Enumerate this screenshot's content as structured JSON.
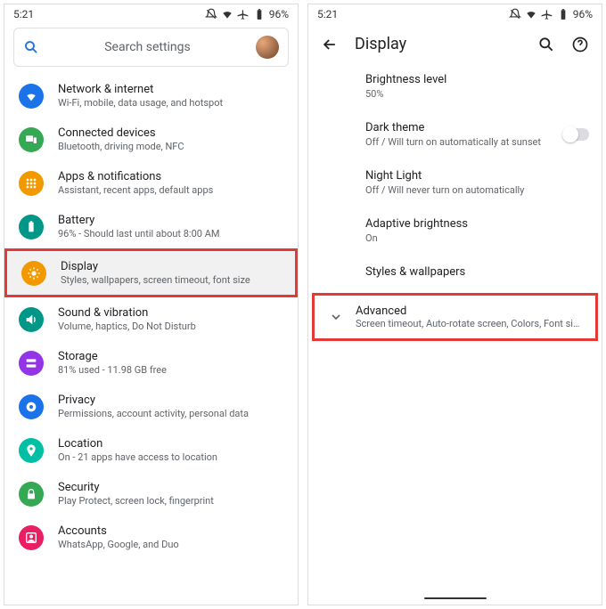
{
  "status": {
    "time": "5:21",
    "battery": "96%"
  },
  "search": {
    "placeholder": "Search settings"
  },
  "settings": [
    {
      "icon": "wifi",
      "color": "#1a73e8",
      "title": "Network & internet",
      "sub": "Wi-Fi, mobile, data usage, and hotspot"
    },
    {
      "icon": "devices",
      "color": "#34a853",
      "title": "Connected devices",
      "sub": "Bluetooth, driving mode, NFC"
    },
    {
      "icon": "apps",
      "color": "#f29900",
      "title": "Apps & notifications",
      "sub": "Assistant, recent apps, default apps"
    },
    {
      "icon": "battery",
      "color": "#009688",
      "title": "Battery",
      "sub": "96% - Should last until about 8:00 AM"
    },
    {
      "icon": "display",
      "color": "#f29900",
      "title": "Display",
      "sub": "Styles, wallpapers, screen timeout, font size",
      "highlight": true
    },
    {
      "icon": "sound",
      "color": "#009688",
      "title": "Sound & vibration",
      "sub": "Volume, haptics, Do Not Disturb"
    },
    {
      "icon": "storage",
      "color": "#9334e6",
      "title": "Storage",
      "sub": "81% used - 11.98 GB free"
    },
    {
      "icon": "privacy",
      "color": "#1a73e8",
      "title": "Privacy",
      "sub": "Permissions, account activity, personal data"
    },
    {
      "icon": "location",
      "color": "#00bfa5",
      "title": "Location",
      "sub": "On - 21 apps have access to location"
    },
    {
      "icon": "security",
      "color": "#34a853",
      "title": "Security",
      "sub": "Play Protect, screen lock, fingerprint"
    },
    {
      "icon": "accounts",
      "color": "#e91e63",
      "title": "Accounts",
      "sub": "WhatsApp, Google, and Duo"
    }
  ],
  "display": {
    "title": "Display",
    "items": [
      {
        "title": "Brightness level",
        "sub": "50%"
      },
      {
        "title": "Dark theme",
        "sub": "Off / Will turn on automatically at sunset",
        "toggle": true
      },
      {
        "title": "Night Light",
        "sub": "Off / Will never turn on automatically"
      },
      {
        "title": "Adaptive brightness",
        "sub": "On"
      },
      {
        "title": "Styles & wallpapers",
        "sub": ""
      }
    ],
    "advanced": {
      "title": "Advanced",
      "sub": "Screen timeout, Auto-rotate screen, Colors, Font size, Di..."
    }
  }
}
